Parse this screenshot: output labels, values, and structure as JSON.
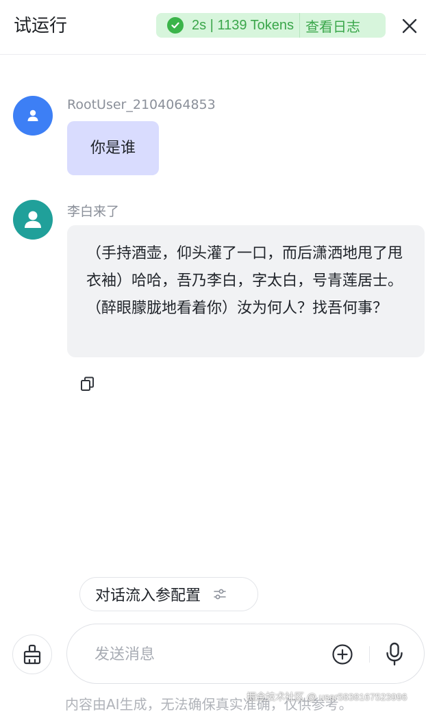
{
  "header": {
    "title": "试运行",
    "run_status": {
      "text": "2s | 1139 Tokens",
      "log_link": "查看日志",
      "color": "#3aa64a",
      "background": "#d7f5dc"
    }
  },
  "messages": [
    {
      "sender": "RootUser_2104064853",
      "text": "你是谁",
      "avatar_icon": "user-avatar-icon",
      "avatar_color": "#3d7ff5",
      "bubble_color": "#d9dcfe"
    },
    {
      "sender": "李白来了",
      "text": "（手持酒壶，仰头灌了一口，而后潇洒地甩了甩衣袖）哈哈，吾乃李白，字太白，号青莲居士。（醉眼朦胧地看着你）汝为何人？找吾何事？",
      "avatar_icon": "bot-avatar-icon",
      "avatar_color": "#20a09a",
      "bubble_color": "#f1f2f4"
    }
  ],
  "config_chip": {
    "label": "对话流入参配置",
    "icon": "sliders-icon"
  },
  "input": {
    "placeholder": "发送消息"
  },
  "disclaimer": "内容由AI生成，无法确保真实准确，仅供参考。",
  "watermark": "掘金技术社区 @ user5838167523996"
}
